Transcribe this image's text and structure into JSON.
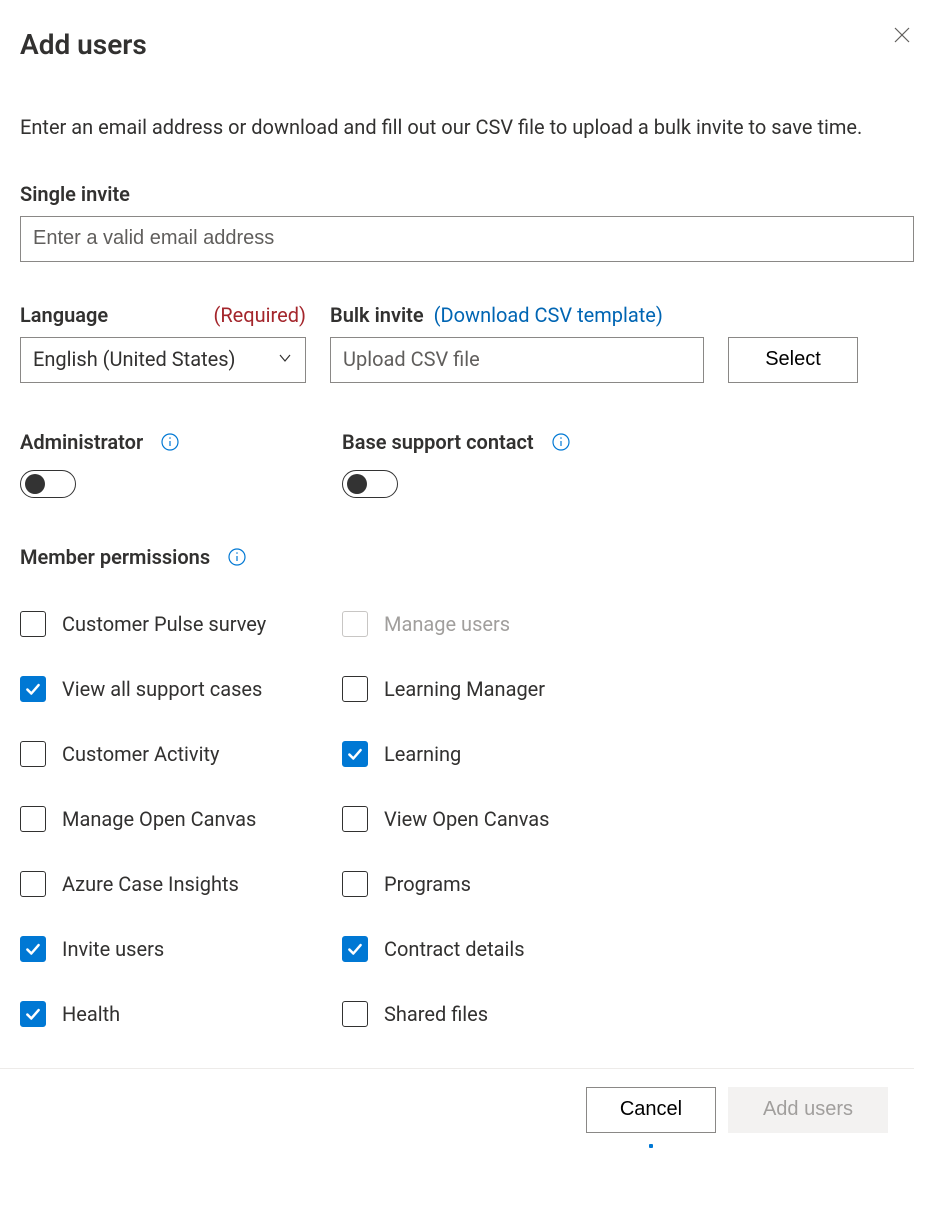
{
  "title": "Add users",
  "intro": "Enter an email address or download and fill out our CSV file to upload a bulk invite to save time.",
  "singleInvite": {
    "label": "Single invite",
    "placeholder": "Enter a valid email address"
  },
  "language": {
    "label": "Language",
    "requiredText": "(Required)",
    "value": "English (United States)"
  },
  "bulkInvite": {
    "label": "Bulk invite",
    "linkText": "(Download CSV template)",
    "uploadPlaceholder": "Upload CSV file",
    "selectLabel": "Select"
  },
  "toggles": {
    "admin": {
      "label": "Administrator",
      "on": false
    },
    "baseSupport": {
      "label": "Base support contact",
      "on": false
    }
  },
  "memberPermissions": {
    "label": "Member permissions",
    "items": [
      {
        "key": "customer-pulse-survey",
        "label": "Customer Pulse survey",
        "checked": false,
        "disabled": false
      },
      {
        "key": "manage-users",
        "label": "Manage users",
        "checked": false,
        "disabled": true
      },
      {
        "key": "view-all-support-cases",
        "label": "View all support cases",
        "checked": true,
        "disabled": false
      },
      {
        "key": "learning-manager",
        "label": "Learning Manager",
        "checked": false,
        "disabled": false
      },
      {
        "key": "customer-activity",
        "label": "Customer Activity",
        "checked": false,
        "disabled": false
      },
      {
        "key": "learning",
        "label": "Learning",
        "checked": true,
        "disabled": false
      },
      {
        "key": "manage-open-canvas",
        "label": "Manage Open Canvas",
        "checked": false,
        "disabled": false
      },
      {
        "key": "view-open-canvas",
        "label": "View Open Canvas",
        "checked": false,
        "disabled": false
      },
      {
        "key": "azure-case-insights",
        "label": "Azure Case Insights",
        "checked": false,
        "disabled": false
      },
      {
        "key": "programs",
        "label": "Programs",
        "checked": false,
        "disabled": false
      },
      {
        "key": "invite-users",
        "label": "Invite users",
        "checked": true,
        "disabled": false
      },
      {
        "key": "contract-details",
        "label": "Contract details",
        "checked": true,
        "disabled": false
      },
      {
        "key": "health",
        "label": "Health",
        "checked": true,
        "disabled": false
      },
      {
        "key": "shared-files",
        "label": "Shared files",
        "checked": false,
        "disabled": false
      }
    ]
  },
  "footer": {
    "cancel": "Cancel",
    "addUsers": "Add users"
  }
}
